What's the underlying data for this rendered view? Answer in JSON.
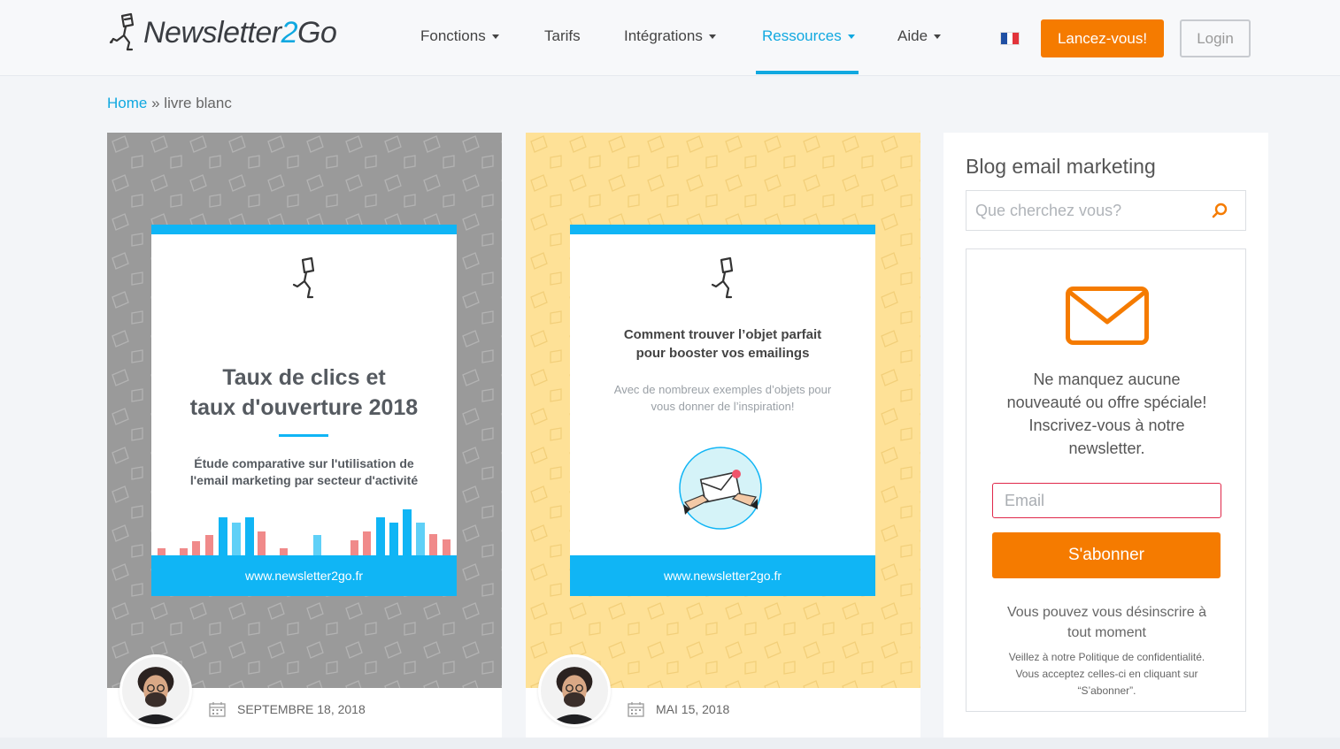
{
  "header": {
    "logo_main": "Newsletter",
    "logo_two": "2",
    "logo_go": "Go",
    "nav": [
      {
        "label": "Fonctions",
        "dropdown": true
      },
      {
        "label": "Tarifs",
        "dropdown": false
      },
      {
        "label": "Intégrations",
        "dropdown": true
      },
      {
        "label": "Ressources",
        "dropdown": true,
        "active": true
      },
      {
        "label": "Aide",
        "dropdown": true
      }
    ],
    "language": "fr",
    "cta_label": "Lancez-vous!",
    "login_label": "Login"
  },
  "breadcrumb": {
    "home": "Home",
    "separator": "»",
    "current": "livre blanc"
  },
  "posts": [
    {
      "ebook_title_line1": "Taux de clics et",
      "ebook_title_line2": "taux d'ouverture 2018",
      "ebook_sub_line1": "Étude comparative sur l'utilisation de",
      "ebook_sub_line2": "l'email marketing par secteur d'activité",
      "ebook_footer": "www.newsletter2go.fr",
      "date": "SEPTEMBRE 18, 2018"
    },
    {
      "ebook_title_line1": "Comment trouver l’objet parfait",
      "ebook_title_line2": "pour booster vos emailings",
      "ebook_sub_line1": "Avec de nombreux exemples d’objets pour",
      "ebook_sub_line2": "vous donner de l’inspiration!",
      "ebook_footer": "www.newsletter2go.fr",
      "date": "MAI 15, 2018"
    }
  ],
  "sidebar": {
    "title": "Blog email marketing",
    "search_placeholder": "Que cherchez vous?",
    "newsletter_line1": "Ne manquez aucune",
    "newsletter_line2": "nouveauté ou offre spéciale!",
    "newsletter_line3": "Inscrivez-vous à notre",
    "newsletter_line4": "newsletter.",
    "email_placeholder": "Email",
    "subscribe_label": "S'abonner",
    "unsub_line1": "Vous pouvez vous désinscrire à",
    "unsub_line2": "tout moment",
    "privacy_line1": "Veillez à notre Politique de confidentialité.",
    "privacy_line2": "Vous acceptez celles-ci en cliquant sur",
    "privacy_line3": "“S’abonner”."
  },
  "colors": {
    "accent_blue": "#10a8e0",
    "cta_orange": "#f57b00",
    "ebook_blue": "#10b5f5",
    "cover_gray": "#9a9a9a",
    "cover_yellow": "#fee197",
    "error_red": "#e0284a"
  },
  "icons": [
    "logo-runner-icon",
    "caret-down-icon",
    "france-flag-icon",
    "calendar-icon",
    "search-icon",
    "envelope-icon",
    "author-avatar"
  ]
}
